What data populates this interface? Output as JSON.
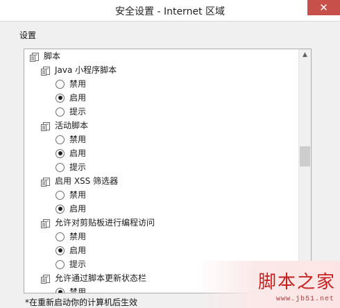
{
  "window": {
    "title": "安全设置 - Internet 区域",
    "close_glyph": "✕"
  },
  "settings": {
    "group_label": "设置",
    "items": [
      {
        "type": "category",
        "label": "脚本",
        "level": 0
      },
      {
        "type": "setting",
        "label": "Java 小程序脚本",
        "level": 1
      },
      {
        "type": "option",
        "label": "禁用",
        "checked": false,
        "level": 2
      },
      {
        "type": "option",
        "label": "启用",
        "checked": true,
        "level": 2
      },
      {
        "type": "option",
        "label": "提示",
        "checked": false,
        "level": 2
      },
      {
        "type": "setting",
        "label": "活动脚本",
        "level": 1
      },
      {
        "type": "option",
        "label": "禁用",
        "checked": false,
        "level": 2
      },
      {
        "type": "option",
        "label": "启用",
        "checked": true,
        "level": 2
      },
      {
        "type": "option",
        "label": "提示",
        "checked": false,
        "level": 2
      },
      {
        "type": "setting",
        "label": "启用 XSS 筛选器",
        "level": 1
      },
      {
        "type": "option",
        "label": "禁用",
        "checked": false,
        "level": 2
      },
      {
        "type": "option",
        "label": "启用",
        "checked": true,
        "level": 2
      },
      {
        "type": "setting",
        "label": "允许对剪贴板进行编程访问",
        "level": 1
      },
      {
        "type": "option",
        "label": "禁用",
        "checked": false,
        "level": 2
      },
      {
        "type": "option",
        "label": "启用",
        "checked": true,
        "level": 2
      },
      {
        "type": "option",
        "label": "提示",
        "checked": false,
        "level": 2
      },
      {
        "type": "setting",
        "label": "允许通过脚本更新状态栏",
        "level": 1
      },
      {
        "type": "option",
        "label": "禁用",
        "checked": true,
        "level": 2
      }
    ]
  },
  "scrollbar": {
    "up_glyph": "▲",
    "down_glyph": "▼"
  },
  "footnote": "*在重新启动你的计算机后生效",
  "watermark": {
    "title": "脚本之家",
    "url": "www.jb51.net"
  }
}
